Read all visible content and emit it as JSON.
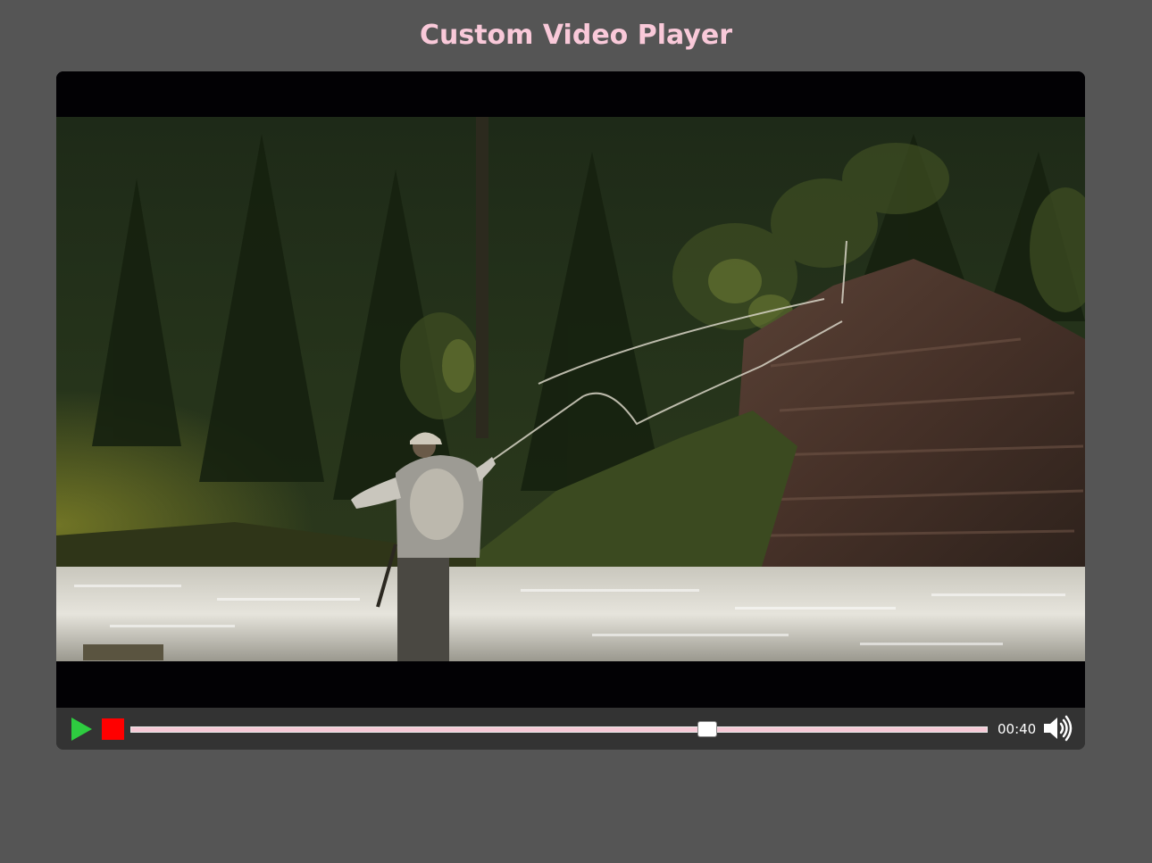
{
  "page": {
    "title": "Custom Video Player"
  },
  "player": {
    "current_time": "00:40",
    "progress_fraction": 0.673,
    "icons": {
      "play": "play-icon",
      "stop": "stop-icon",
      "volume": "volume-icon"
    },
    "colors": {
      "title": "#f9c9d9",
      "play": "#2ecc40",
      "stop": "#ff0000",
      "progress_track": "#f6c9d6",
      "background": "#555555",
      "controls_bar": "#333333"
    }
  }
}
